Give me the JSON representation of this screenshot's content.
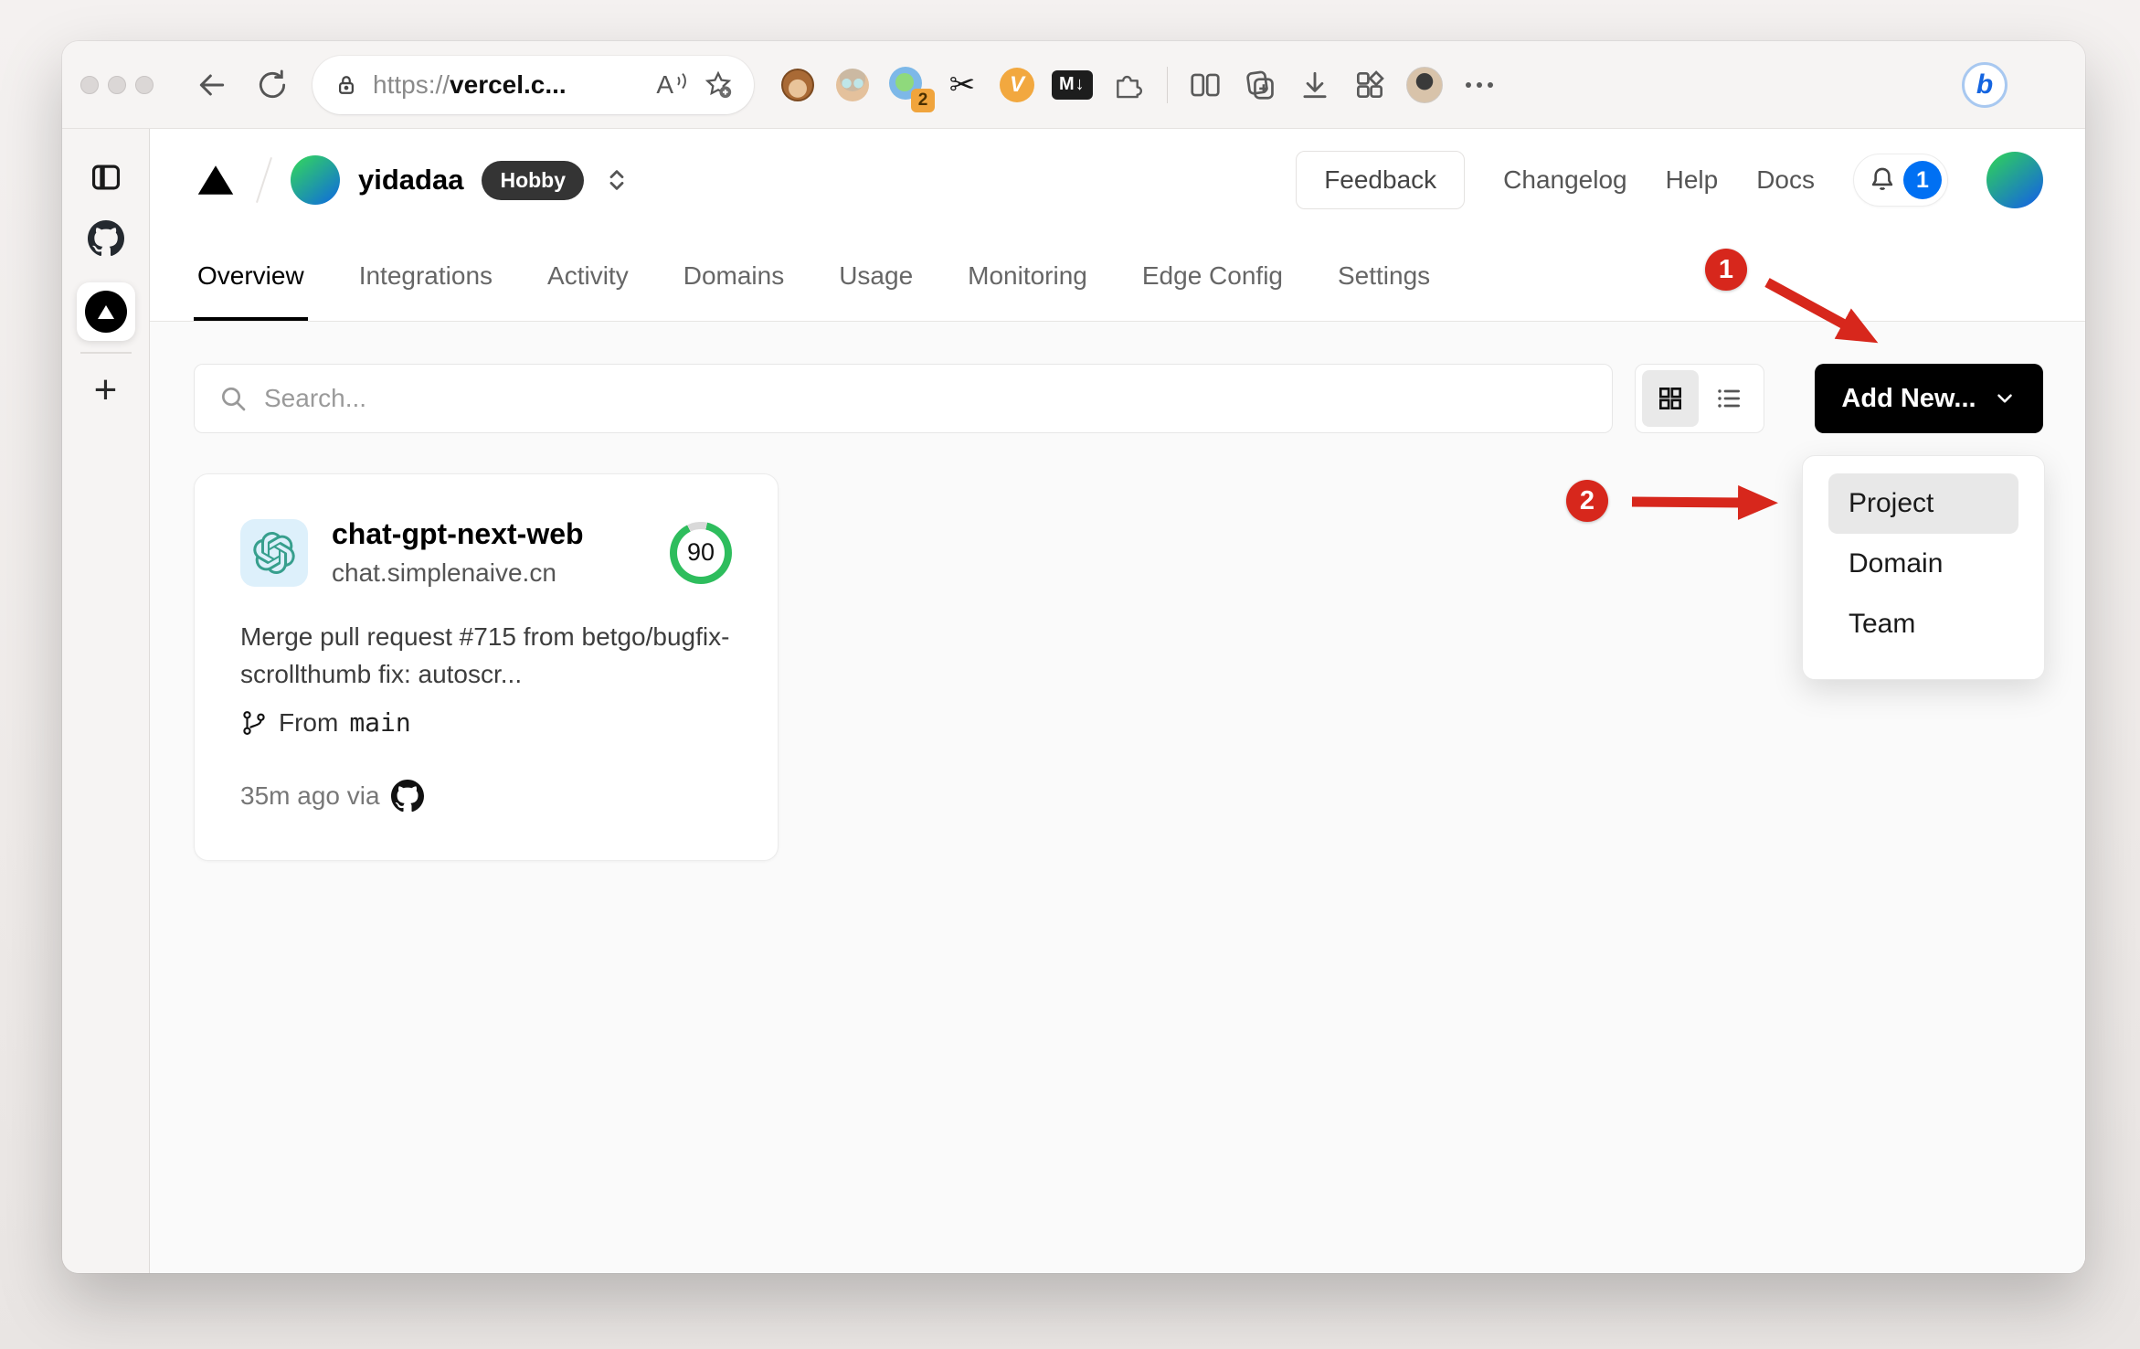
{
  "browser": {
    "url_scheme": "https://",
    "url_host": "vercel.c...",
    "read_aloud_glyph": "A",
    "extension_badge": "2",
    "scissors_glyph": "✂",
    "v_ext_label": "V",
    "md_ext_label": "M↓",
    "bing_label": "b"
  },
  "sidebar": {
    "plus_glyph": "+"
  },
  "header": {
    "team_name": "yidadaa",
    "plan_badge": "Hobby",
    "feedback_label": "Feedback",
    "links": [
      "Changelog",
      "Help",
      "Docs"
    ],
    "notification_count": "1"
  },
  "nav": {
    "tabs": [
      "Overview",
      "Integrations",
      "Activity",
      "Domains",
      "Usage",
      "Monitoring",
      "Edge Config",
      "Settings"
    ]
  },
  "toolbar": {
    "search_placeholder": "Search...",
    "add_new_label": "Add New..."
  },
  "dropdown": {
    "items": [
      "Project",
      "Domain",
      "Team"
    ]
  },
  "project_card": {
    "name": "chat-gpt-next-web",
    "domain": "chat.simplenaive.cn",
    "score": "90",
    "commit_message": "Merge pull request #715 from betgo/bugfix-scrollthumb fix: autoscr...",
    "branch_label": "From",
    "branch_name": "main",
    "deployed_text": "35m ago via"
  },
  "annotations": {
    "step1": "1",
    "step2": "2",
    "color": "#d7271c",
    "score_green": "#2ebd5d",
    "accent_blue": "#0070f3"
  }
}
